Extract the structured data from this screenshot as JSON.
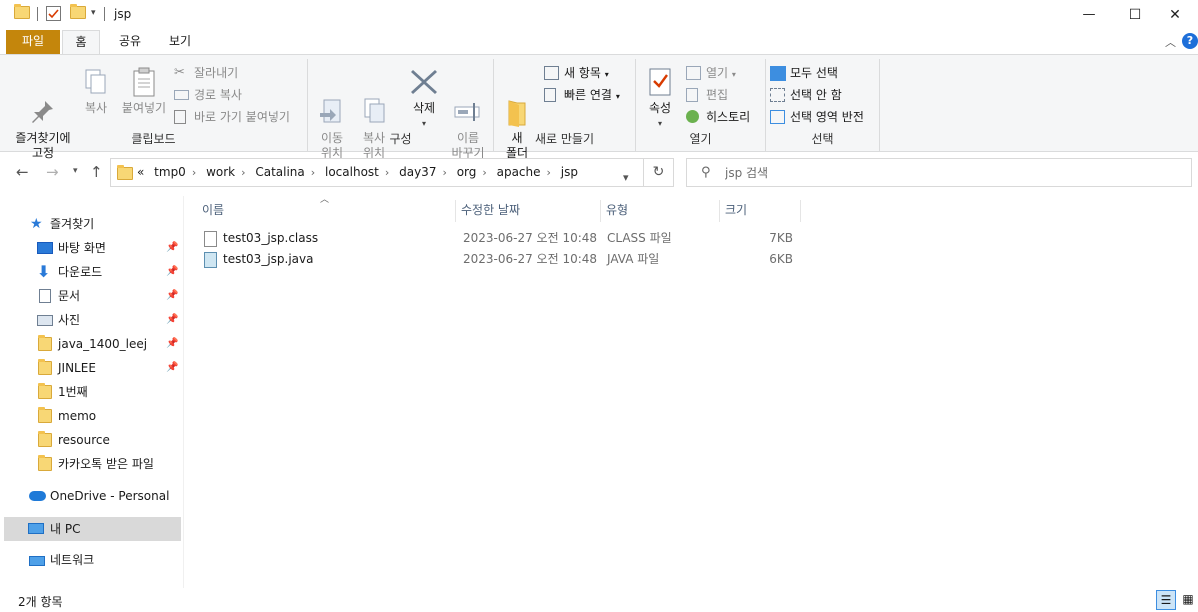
{
  "window": {
    "title": "jsp",
    "controls": {
      "minimize": "—",
      "maximize": "☐",
      "close": "✕"
    }
  },
  "ribbon_tabs": [
    {
      "label": "파일"
    },
    {
      "label": "홈"
    },
    {
      "label": "공유"
    },
    {
      "label": "보기"
    }
  ],
  "ribbon": {
    "clipboard": {
      "pin_label": "즐겨찾기에\n고정",
      "copy_label": "복사",
      "paste_label": "붙여넣기",
      "cut_label": "잘라내기",
      "copy_path_label": "경로 복사",
      "paste_shortcut_label": "바로 가기 붙여넣기",
      "group_label": "클립보드"
    },
    "organize": {
      "move_label": "이동\n위치",
      "copyto_label": "복사\n위치",
      "delete_label": "삭제",
      "rename_label": "이름\n바꾸기",
      "group_label": "구성"
    },
    "new": {
      "folder_label": "새\n폴더",
      "new_item_label": "새 항목",
      "easy_access_label": "빠른 연결",
      "group_label": "새로 만들기"
    },
    "open": {
      "properties_label": "속성",
      "open_label": "열기",
      "edit_label": "편집",
      "history_label": "히스토리",
      "group_label": "열기"
    },
    "select": {
      "select_all_label": "모두 선택",
      "select_none_label": "선택 안 함",
      "invert_label": "선택 영역 반전",
      "group_label": "선택"
    }
  },
  "address": {
    "prefix": "«",
    "crumbs": [
      "tmp0",
      "work",
      "Catalina",
      "localhost",
      "day37",
      "org",
      "apache",
      "jsp"
    ]
  },
  "search": {
    "placeholder": "jsp 검색"
  },
  "nav_pane": {
    "quick_access_label": "즐겨찾기",
    "items": [
      {
        "label": "바탕 화면",
        "icon": "desktop-icon",
        "pinned": true
      },
      {
        "label": "다운로드",
        "icon": "download-icon",
        "pinned": true
      },
      {
        "label": "문서",
        "icon": "documents-icon",
        "pinned": true
      },
      {
        "label": "사진",
        "icon": "pictures-icon",
        "pinned": true
      },
      {
        "label": "java_1400_leej",
        "icon": "folder-icon",
        "pinned": true
      },
      {
        "label": "JINLEE",
        "icon": "folder-icon",
        "pinned": true
      },
      {
        "label": "1번째",
        "icon": "folder-icon",
        "pinned": false
      },
      {
        "label": "memo",
        "icon": "folder-icon",
        "pinned": false
      },
      {
        "label": "resource",
        "icon": "folder-icon",
        "pinned": false
      },
      {
        "label": "카카오톡 받은 파일",
        "icon": "folder-icon",
        "pinned": false
      }
    ],
    "onedrive_label": "OneDrive - Personal",
    "thispc_label": "내 PC",
    "network_label": "네트워크"
  },
  "file_list": {
    "columns": {
      "name": "이름",
      "date": "수정한 날짜",
      "type": "유형",
      "size": "크기"
    },
    "rows": [
      {
        "name": "test03_jsp.class",
        "date": "2023-06-27 오전 10:48",
        "type": "CLASS 파일",
        "size": "7KB",
        "icon": "class-file-icon"
      },
      {
        "name": "test03_jsp.java",
        "date": "2023-06-27 오전 10:48",
        "type": "JAVA 파일",
        "size": "6KB",
        "icon": "java-file-icon"
      }
    ]
  },
  "status": {
    "item_count": "2개 항목"
  }
}
